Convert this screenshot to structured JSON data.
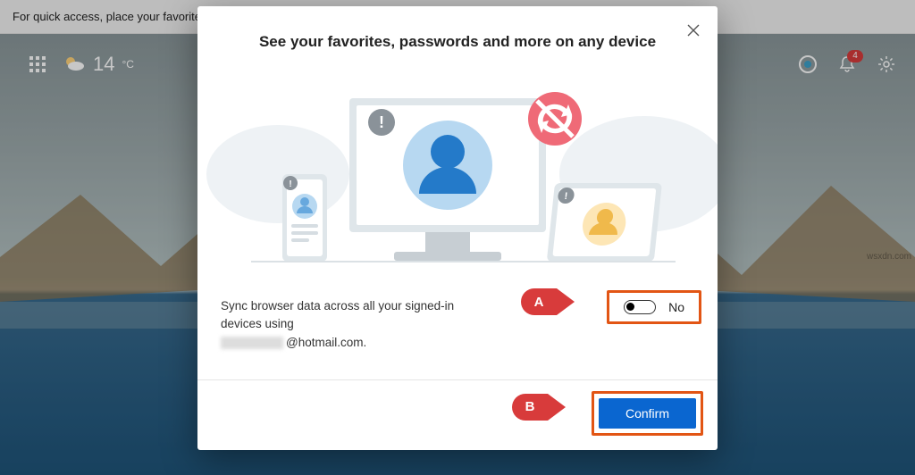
{
  "info_bar": {
    "text": "For quick access, place your favorites h"
  },
  "top_left": {
    "temperature": "14",
    "unit": "°C"
  },
  "notifications": {
    "count": "4"
  },
  "modal": {
    "title": "See your favorites, passwords and more on any device",
    "sync_text": "Sync browser data across all your signed-in devices using",
    "email_domain": "@hotmail.com.",
    "toggle_label": "No",
    "confirm_label": "Confirm"
  },
  "callouts": {
    "a": "A",
    "b": "B"
  },
  "watermark": "wsxdn.com"
}
